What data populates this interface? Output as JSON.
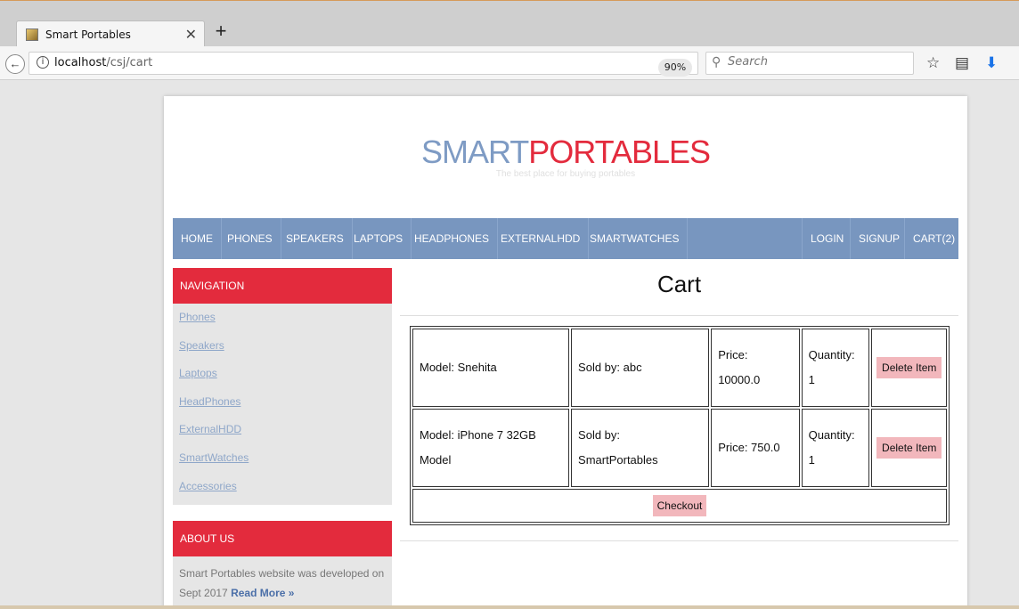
{
  "browser": {
    "tab_title": "Smart Portables",
    "url_host": "localhost",
    "url_path": "/csj/cart",
    "zoom": "90%",
    "search_placeholder": "Search"
  },
  "site": {
    "logo_part1": "SMART",
    "logo_part2": "PORTABLES",
    "tagline": "The best place for buying portables",
    "nav_left": [
      "HOME",
      "PHONES",
      "SPEAKERS",
      "LAPTOPS",
      "HEADPHONES",
      "EXTERNALHDD",
      "SMARTWATCHES"
    ],
    "nav_right": [
      "LOGIN",
      "SIGNUP",
      "CART(2)"
    ],
    "colors": {
      "nav": "#7896bf",
      "accent": "#e32b3d",
      "button": "#f2b7bc"
    }
  },
  "sidebar": {
    "navigation_title": "NAVIGATION",
    "links": [
      "Phones",
      "Speakers",
      "Laptops",
      "HeadPhones",
      "ExternalHDD",
      "SmartWatches",
      "Accessories"
    ],
    "about_title": "ABOUT US",
    "about_text": "Smart Portables website was developed on Sept 2017",
    "read_more": "Read More »"
  },
  "cart": {
    "title": "Cart",
    "items": [
      {
        "model": "Model: Snehita",
        "sold_by": "Sold by: abc",
        "price": "Price: 10000.0",
        "quantity": "Quantity: 1",
        "delete_label": "Delete Item"
      },
      {
        "model": "Model: iPhone 7 32GB Model",
        "sold_by": "Sold by: SmartPortables",
        "price": "Price: 750.0",
        "quantity": "Quantity: 1",
        "delete_label": "Delete Item"
      }
    ],
    "checkout_label": "Checkout"
  }
}
